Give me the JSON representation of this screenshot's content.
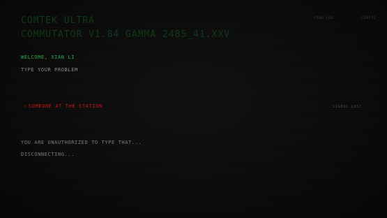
{
  "header": {
    "title_line1": "COMTEK ULTRA",
    "title_line2": "COMMUTATOR V1.84 GAMMA 2485_41.XXV"
  },
  "topnav": {
    "items": [
      "PING LOG",
      "CONFIG"
    ]
  },
  "terminal": {
    "welcome": "WELCOME, XIAN LI",
    "prompt": "TYPE YOUR PROBLEM",
    "option_arrow": "›",
    "option_label": "SOMEONE AT THE STATION",
    "signal_status": "SIGNAL LOST",
    "response": "YOU ARE UNAUTHORIZED TO TYPE THAT...",
    "status": "DISCONNECTING..."
  },
  "colors": {
    "background": "#0b0b0b",
    "title": "#0f3a18",
    "welcome": "#2bb04a",
    "option": "#c41a1a",
    "text": "#7f7f7f"
  }
}
